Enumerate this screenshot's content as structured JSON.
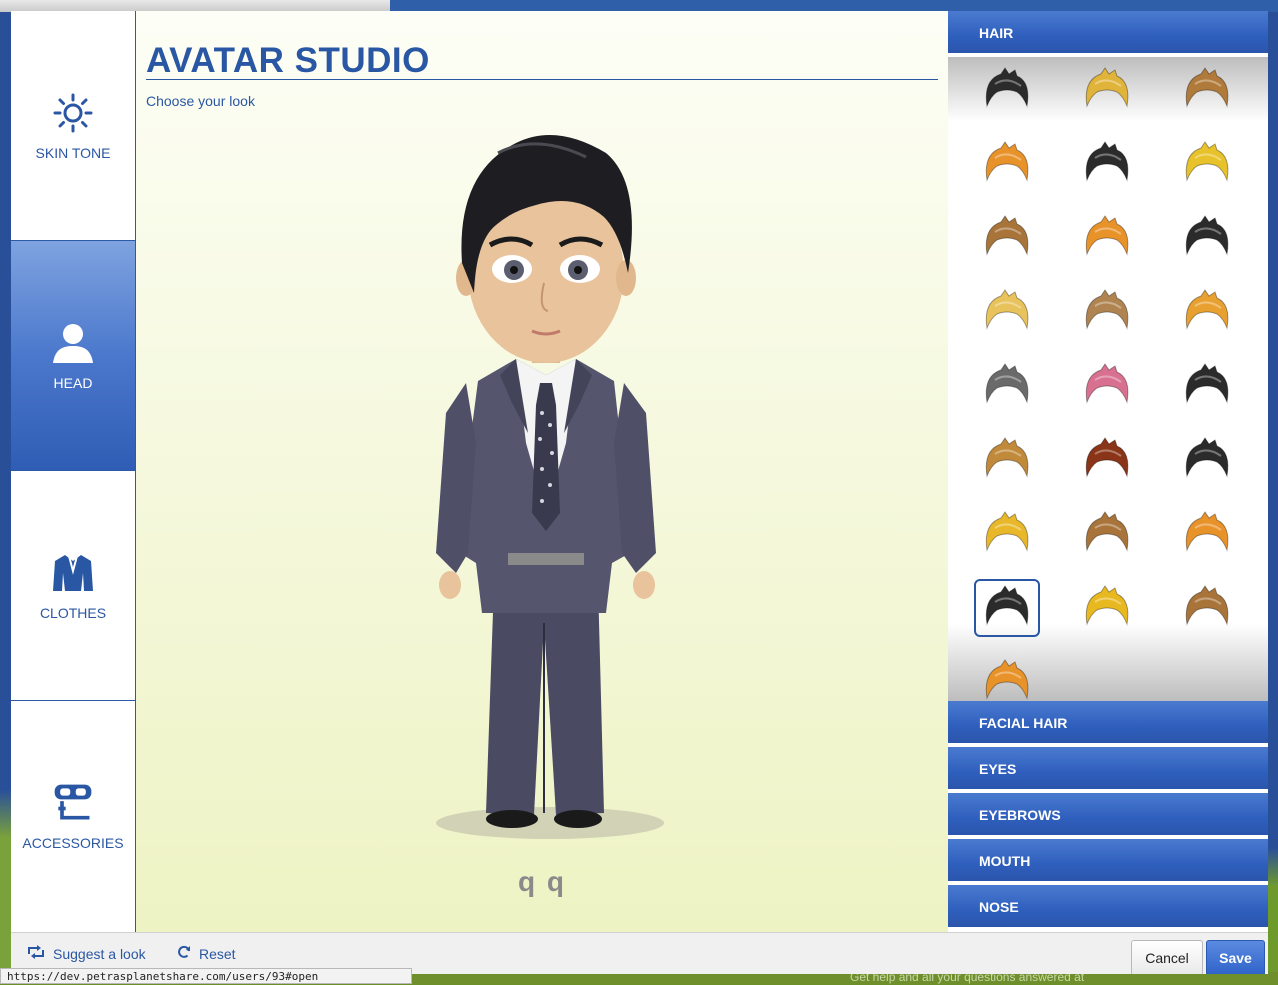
{
  "backdrop": {
    "footer_text": "Get help and all your questions answered at"
  },
  "modal": {
    "title": "AVATAR STUDIO",
    "subtitle": "Choose your look",
    "avatar_name": "q q"
  },
  "categories": [
    {
      "label": "SKIN TONE",
      "icon": "sun-icon",
      "active": false
    },
    {
      "label": "HEAD",
      "icon": "person-icon",
      "active": true
    },
    {
      "label": "CLOTHES",
      "icon": "jacket-icon",
      "active": false
    },
    {
      "label": "ACCESSORIES",
      "icon": "goggles-snorkel-icon",
      "active": false
    }
  ],
  "options": {
    "hair_label": "HAIR",
    "sections": [
      "FACIAL HAIR",
      "EYES",
      "EYEBROWS",
      "MOUTH",
      "NOSE"
    ],
    "hair_colors": [
      "#2b2b2b",
      "#e0b43a",
      "#b07a3a",
      "#e8922a",
      "#2b2b2b",
      "#e8c22a",
      "#a8743a",
      "#e8922a",
      "#2b2b2b",
      "#e8c25a",
      "#b08450",
      "#e8a030",
      "#6a6a6a",
      "#d87090",
      "#2b2b2b",
      "#c08a3a",
      "#8a3418",
      "#2b2b2b",
      "#e8b82a",
      "#a8743a",
      "#e8922a",
      "#2b2b2b",
      "#e8b820",
      "#a8743a",
      "#e8922a"
    ],
    "selected_hair_index": 21
  },
  "footer": {
    "suggest_label": "Suggest a look",
    "reset_label": "Reset",
    "cancel_label": "Cancel",
    "save_label": "Save"
  },
  "status_url": "https://dev.petrasplanetshare.com/users/93#open",
  "colors": {
    "accent": "#2a57a4",
    "active_tab": "#4b78cc"
  }
}
